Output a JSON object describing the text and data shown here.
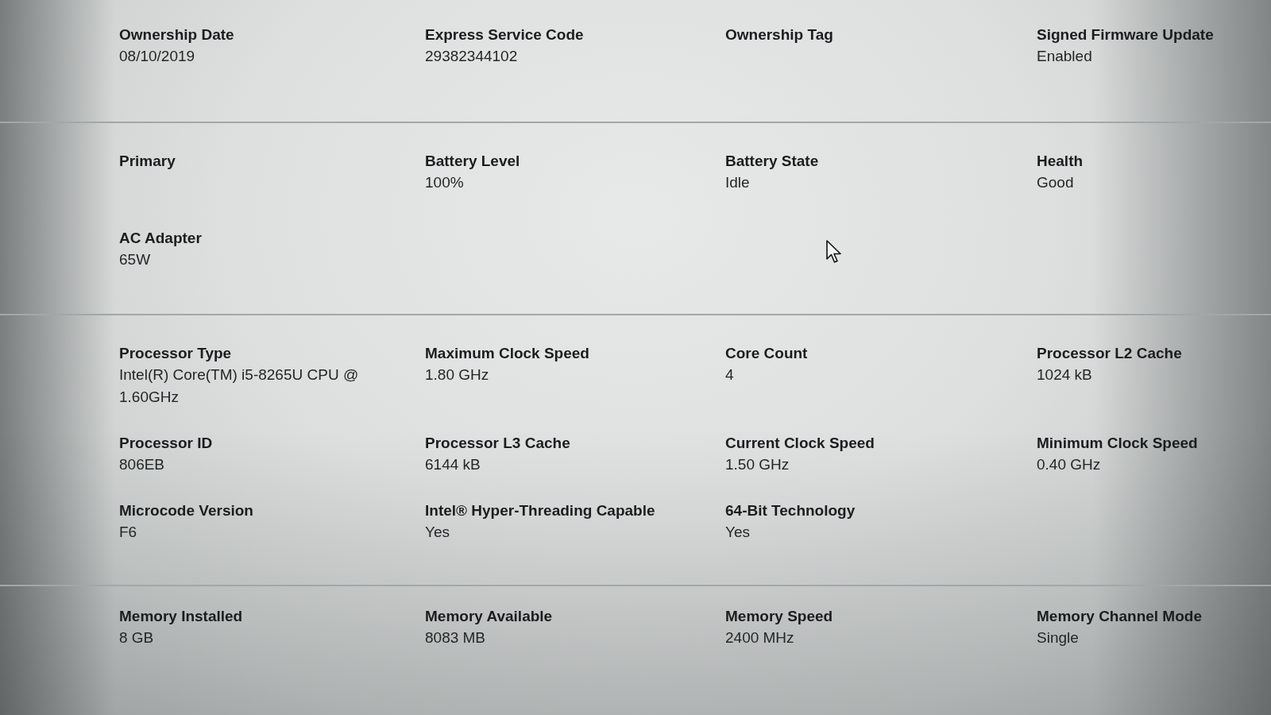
{
  "sections": [
    {
      "rows": [
        [
          {
            "label": "Ownership Date",
            "value": "08/10/2019"
          },
          {
            "label": "Express Service Code",
            "value": "29382344102"
          },
          {
            "label": "Ownership Tag"
          },
          {
            "label": "Signed Firmware Update",
            "value": "Enabled"
          }
        ]
      ]
    },
    {
      "rows": [
        [
          {
            "label": "Primary"
          },
          {
            "label": "Battery Level",
            "value": "100%"
          },
          {
            "label": "Battery State",
            "value": "Idle"
          },
          {
            "label": "Health",
            "value": "Good"
          }
        ],
        [
          {
            "label": "AC Adapter",
            "value": "65W"
          }
        ]
      ]
    },
    {
      "rows": [
        [
          {
            "label": "Processor Type",
            "value": "Intel(R) Core(TM) i5-8265U CPU @ 1.60GHz"
          },
          {
            "label": "Maximum Clock Speed",
            "value": "1.80 GHz"
          },
          {
            "label": "Core Count",
            "value": "4"
          },
          {
            "label": "Processor L2 Cache",
            "value": "1024 kB"
          }
        ],
        [
          {
            "label": "Processor ID",
            "value": "806EB"
          },
          {
            "label": "Processor L3 Cache",
            "value": "6144 kB"
          },
          {
            "label": "Current Clock Speed",
            "value": "1.50 GHz"
          },
          {
            "label": "Minimum Clock Speed",
            "value": "0.40 GHz"
          }
        ],
        [
          {
            "label": "Microcode Version",
            "value": "F6"
          },
          {
            "label": "Intel® Hyper-Threading Capable",
            "value": "Yes"
          },
          {
            "label": "64-Bit Technology",
            "value": "Yes"
          }
        ]
      ]
    },
    {
      "rows": [
        [
          {
            "label": "Memory Installed",
            "value": "8 GB"
          },
          {
            "label": "Memory Available",
            "value": "8083 MB"
          },
          {
            "label": "Memory Speed",
            "value": "2400 MHz"
          },
          {
            "label": "Memory Channel Mode",
            "value": "Single"
          }
        ]
      ]
    }
  ]
}
